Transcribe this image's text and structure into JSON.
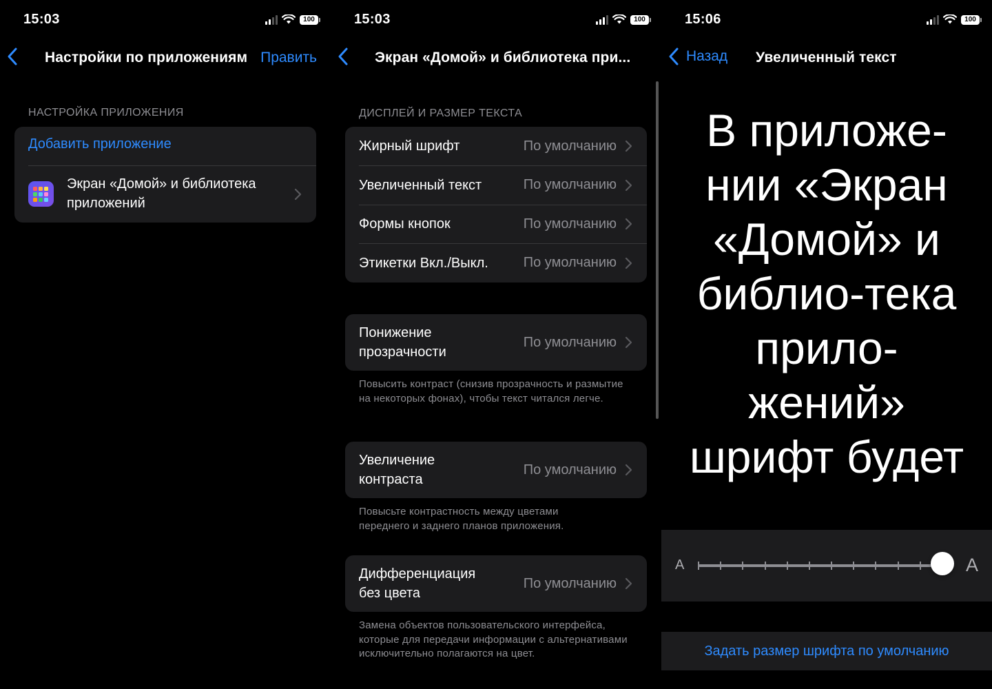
{
  "screen1": {
    "status": {
      "time": "15:03",
      "battery": "100"
    },
    "nav": {
      "title": "Настройки по приложениям",
      "action": "Править"
    },
    "section_header": "НАСТРОЙКА ПРИЛОЖЕНИЯ",
    "add_app": "Добавить приложение",
    "app_item": {
      "label": "Экран «Домой» и библиотека приложений",
      "icon": "app-library-icon"
    }
  },
  "screen2": {
    "status": {
      "time": "15:03",
      "battery": "100"
    },
    "nav": {
      "title": "Экран «Домой» и библиотека при..."
    },
    "section_header": "ДИСПЛЕЙ И РАЗМЕР ТЕКСТА",
    "group1": [
      {
        "label": "Жирный шрифт",
        "value": "По умолчанию"
      },
      {
        "label": "Увеличенный текст",
        "value": "По умолчанию"
      },
      {
        "label": "Формы кнопок",
        "value": "По умолчанию"
      },
      {
        "label": "Этикетки Вкл./Выкл.",
        "value": "По умолчанию"
      }
    ],
    "transparency": {
      "label_line1": "Понижение",
      "label_line2": "прозрачности",
      "value": "По умолчанию",
      "footnote": "Повысить контраст (снизив прозрачность и размытие на некоторых фонах), чтобы текст читался легче."
    },
    "contrast": {
      "label_line1": "Увеличение",
      "label_line2": "контраста",
      "value": "По умолчанию",
      "footnote": "Повысьте контрастность между цветами переднего и заднего планов приложения."
    },
    "differentiate": {
      "label_line1": "Дифференциация",
      "label_line2": "без цвета",
      "value": "По умолчанию",
      "footnote": "Замена объектов пользовательского интерфейса, которые для передачи информации с альтернативами исключительно полагаются на цвет."
    }
  },
  "screen3": {
    "status": {
      "time": "15:06",
      "battery": "100"
    },
    "nav": {
      "back": "Назад",
      "title": "Увеличенный текст"
    },
    "preview_text": "В приложе-нии «Экран «Домой» и библио-тека прило-жений» шрифт будет",
    "slider": {
      "small_label": "A",
      "large_label": "A",
      "steps": 12,
      "position_fraction": 1.0
    },
    "reset": "Задать размер шрифта по умолчанию"
  },
  "colors": {
    "accent": "#2e8bff",
    "cell_bg": "#1c1c1e",
    "secondary_text": "#8e8e93"
  }
}
